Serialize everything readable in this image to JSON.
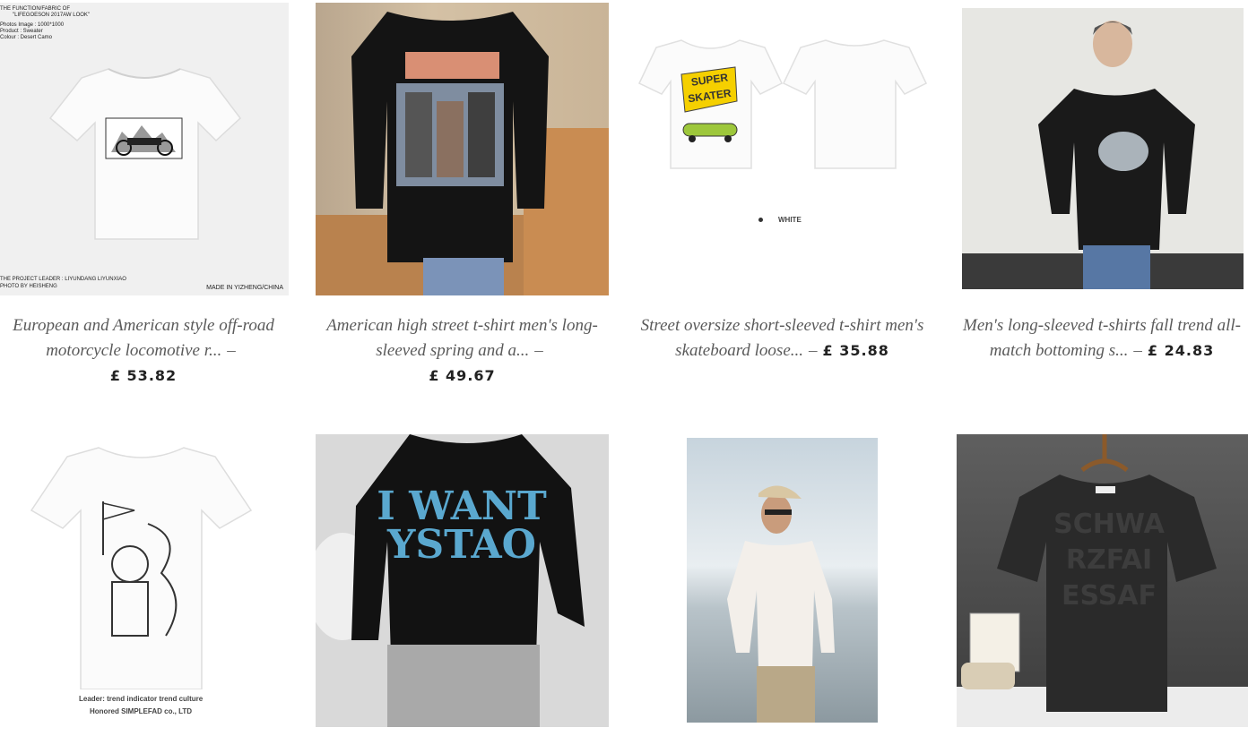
{
  "products": [
    {
      "title": "European and American style off-road motorcycle locomotive r...",
      "price": "£ 53.82",
      "image": {
        "header_line1": "THE FUNCTION/FABRIC OF",
        "header_line2": "\"LIFEGOESON 2017AW LOOK\"",
        "spec1": "Photos Image : 1000*1000",
        "spec2": "Product : Sweater",
        "spec3": "Colour : Desert Camo",
        "footer_left1": "THE PROJECT LEADER : LIYUNDANG LIYUNXIAO",
        "footer_left2": "PHOTO BY HEISHENG",
        "footer_right": "MADE IN YIZHENG/CHINA"
      }
    },
    {
      "title": "American high street t-shirt men's long-sleeved spring and a...",
      "price": "£ 49.67"
    },
    {
      "title": "Street oversize short-sleeved t-shirt men's skateboard loose...",
      "price": "£ 35.88",
      "image": {
        "color_option": "WHITE",
        "print_text": "SUPER SKATER"
      }
    },
    {
      "title": "Men's long-sleeved t-shirts fall trend all-match bottoming s...",
      "price": "£ 24.83"
    },
    {
      "image": {
        "caption_line1": "Leader: trend indicator trend culture",
        "caption_line2": "Honored SIMPLEFAD co., LTD"
      }
    },
    {
      "image": {
        "print_text": "I WANT YSTAO"
      }
    },
    {},
    {}
  ],
  "colors": {
    "text": "#555555",
    "price": "#222222",
    "background": "#ffffff"
  }
}
